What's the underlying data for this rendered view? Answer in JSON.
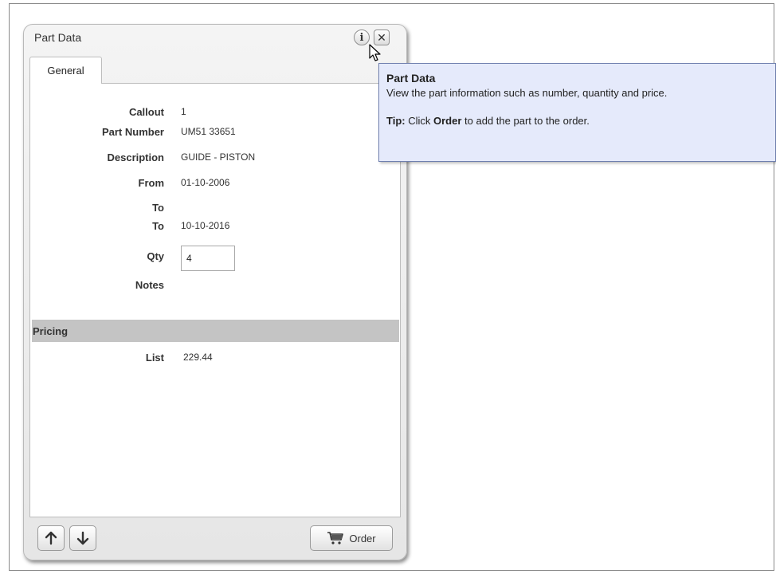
{
  "panel": {
    "title": "Part Data",
    "info_icon": "info-icon",
    "close_icon": "close-icon",
    "tab_label": "General"
  },
  "fields": {
    "callout": {
      "label": "Callout",
      "value": "1"
    },
    "part_number": {
      "label": "Part Number",
      "value": "UM51 33651"
    },
    "description": {
      "label": "Description",
      "value": "GUIDE - PISTON"
    },
    "from": {
      "label": "From",
      "value": "01-10-2006"
    },
    "to_blank": {
      "label": "To",
      "value": ""
    },
    "to": {
      "label": "To",
      "value": "10-10-2016"
    },
    "qty": {
      "label": "Qty",
      "value": "4"
    },
    "notes": {
      "label": "Notes",
      "value": ""
    }
  },
  "pricing": {
    "section_label": "Pricing",
    "list_label": "List",
    "list_value": "229.44"
  },
  "footer": {
    "up_icon": "arrow-up-icon",
    "down_icon": "arrow-down-icon",
    "order_label": "Order",
    "cart_icon": "cart-icon"
  },
  "tooltip": {
    "title": "Part Data",
    "body": "View the part information such as number, quantity and price.",
    "tip_prefix": "Tip:",
    "tip_text_1": "Click",
    "tip_bold": "Order",
    "tip_text_2": "to add the part to the order."
  }
}
